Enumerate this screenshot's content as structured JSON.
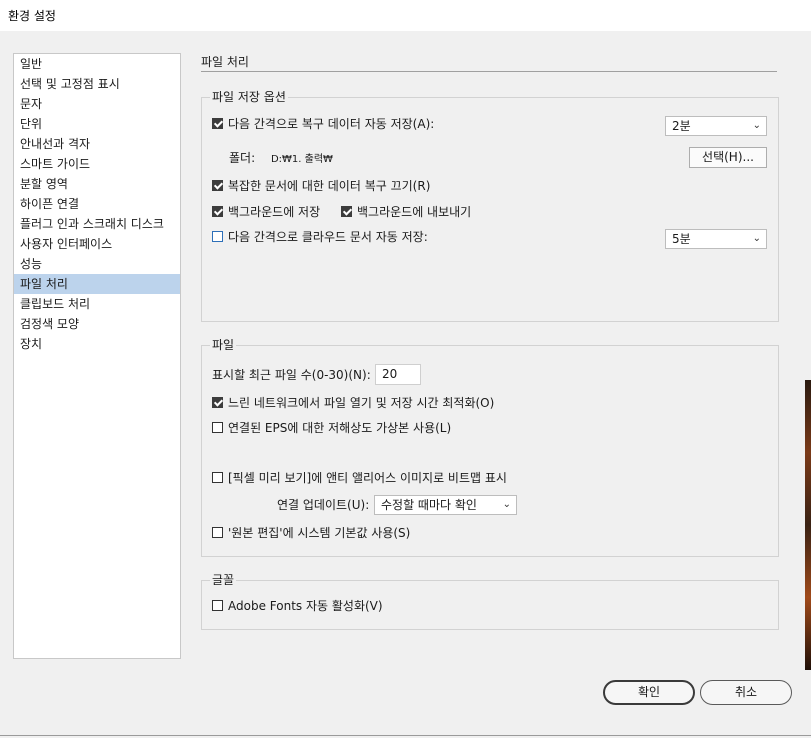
{
  "window": {
    "title": "환경 설정"
  },
  "nav": {
    "items": [
      "일반",
      "선택 및 고정점 표시",
      "문자",
      "단위",
      "안내선과 격자",
      "스마트 가이드",
      "분할 영역",
      "하이픈 연결",
      "플러그 인과 스크래치 디스크",
      "사용자 인터페이스",
      "성능",
      "파일 처리",
      "클립보드 처리",
      "검정색 모양",
      "장치"
    ],
    "selected_index": 11
  },
  "section_title": "파일 처리",
  "save_options": {
    "label": "파일 저장 옵션",
    "autosave_recovery": {
      "label": "다음 간격으로 복구 데이터 자동 저장(A):",
      "checked": true,
      "interval": "2분"
    },
    "folder_label": "폴더:",
    "folder_path": "D:₩1. 출력₩",
    "choose_button": "선택(H)...",
    "complex_docs": {
      "label": "복잡한 문서에 대한 데이터 복구 끄기(R)",
      "checked": true
    },
    "bg_save": {
      "label": "백그라운드에 저장",
      "checked": true
    },
    "bg_export": {
      "label": "백그라운드에 내보내기",
      "checked": true
    },
    "cloud_autosave": {
      "label": "다음 간격으로 클라우드 문서 자동 저장:",
      "checked": false,
      "interval": "5분"
    }
  },
  "file": {
    "label": "파일",
    "recent_files_label": "표시할 최근 파일 수(0-30)(N):",
    "recent_files_value": "20",
    "slow_network": {
      "label": "느린 네트워크에서 파일 열기 및 저장 시간 최적화(O)",
      "checked": true
    },
    "linked_eps": {
      "label": "연결된 EPS에 대한 저해상도 가상본 사용(L)",
      "checked": false
    },
    "pixel_preview": {
      "label": "[픽셀 미리 보기]에 앤티 앨리어스 이미지로 비트맵 표시",
      "checked": false
    },
    "link_update_label": "연결 업데이트(U):",
    "link_update_value": "수정할 때마다 확인",
    "edit_original": {
      "label": "'원본 편집'에 시스템 기본값 사용(S)",
      "checked": false
    }
  },
  "fonts": {
    "label": "글꼴",
    "auto_activate": {
      "label": "Adobe Fonts 자동 활성화(V)",
      "checked": false
    }
  },
  "buttons": {
    "ok": "확인",
    "cancel": "취소"
  }
}
